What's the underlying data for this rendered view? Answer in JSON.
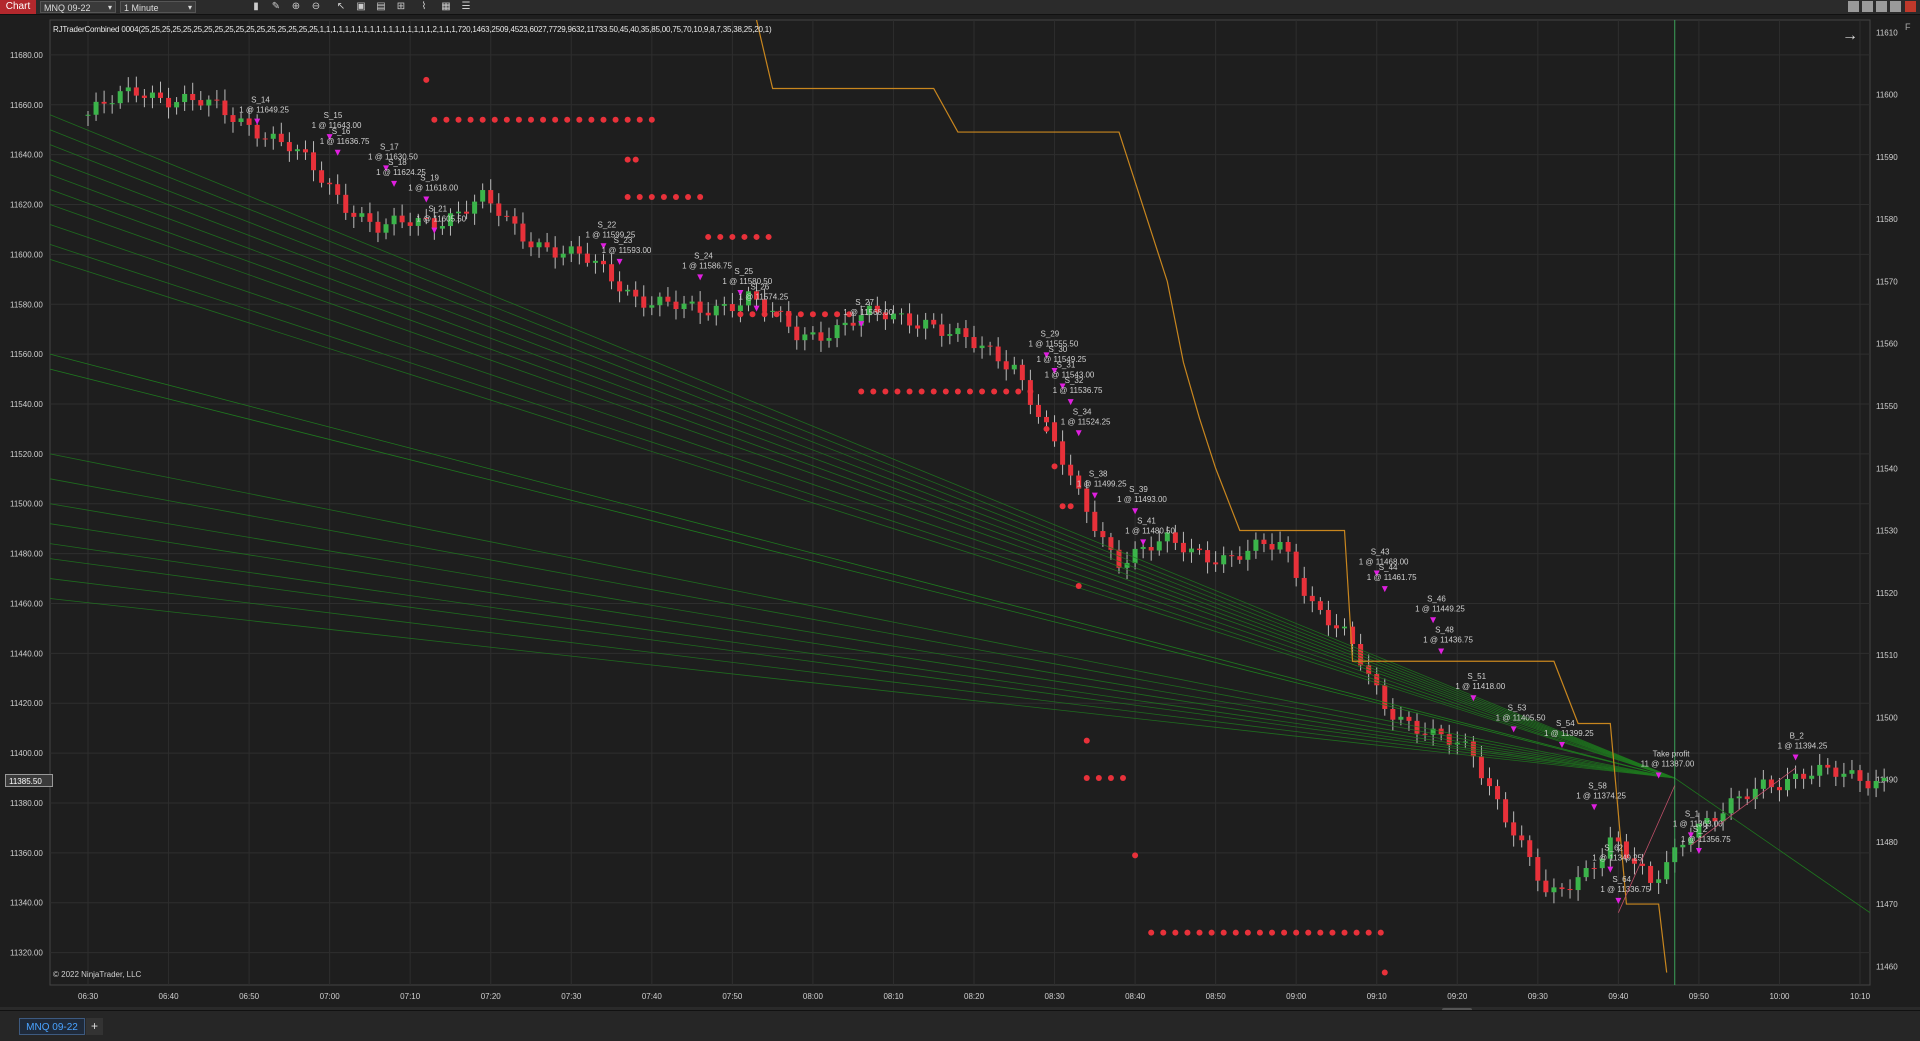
{
  "toolbar": {
    "chart_label": "Chart",
    "instrument": "MNQ 09-22",
    "interval": "1 Minute",
    "tools": [
      "bars-icon",
      "pencil-icon",
      "line-icon",
      "zoom-in-icon",
      "zoom-out-icon",
      "pointer-icon",
      "template-icon",
      "properties-icon",
      "data-box-icon",
      "strategy-icon",
      "indicator-icon",
      "list-icon"
    ]
  },
  "indicator_label": "RJTraderCombined 0004(25,25,25,25,25,25,25,25,25,25,25,25,25,25,25,25,25,1,1,1,1,1,1,1,1,1,1,1,1,1,1,1,1,1,1,2,1,1,1,720,1463,2509,4523,6027,7729,9632,11733.50,45,40,35,85,00,75,70,10,9,8,7,35,38,25,20,1)",
  "copyright": "© 2022 NinjaTrader, LLC",
  "bottom": {
    "instrument_tab": "MNQ 09-22",
    "add_tab": "+"
  },
  "price_marker": "11385.50",
  "corner_label": "F",
  "chart_data": {
    "type": "candlestick",
    "left_axis": {
      "ticks": [
        "11680.00",
        "11660.00",
        "11640.00",
        "11620.00",
        "11600.00",
        "11580.00",
        "11560.00",
        "11540.00",
        "11520.00",
        "11500.00",
        "11480.00",
        "11460.00",
        "11440.00",
        "11420.00",
        "11400.00",
        "11380.00",
        "11360.00",
        "11340.00",
        "11320.00"
      ],
      "range": [
        11307,
        11694
      ]
    },
    "right_axis": {
      "ticks": [
        "11610",
        "11600",
        "11590",
        "11580",
        "11570",
        "11560",
        "11550",
        "11540",
        "11530",
        "11520",
        "11510",
        "11500",
        "11490",
        "11480",
        "11470",
        "11460"
      ],
      "range": [
        11457,
        11612
      ]
    },
    "x_ticks": [
      "06:30",
      "06:40",
      "06:50",
      "07:00",
      "07:10",
      "07:20",
      "07:30",
      "07:40",
      "07:50",
      "08:00",
      "08:10",
      "08:20",
      "08:30",
      "08:40",
      "08:50",
      "09:00",
      "09:10",
      "09:20",
      "09:30",
      "09:40",
      "09:50",
      "10:00",
      "10:10"
    ],
    "trades": [
      {
        "label": "S_14",
        "fill": "1 @ 11649.25",
        "t": "06:51",
        "price": 11649.25
      },
      {
        "label": "S_15",
        "fill": "1 @ 11643.00",
        "t": "07:00",
        "price": 11643.0
      },
      {
        "label": "S_16",
        "fill": "1 @ 11636.75",
        "t": "07:01",
        "price": 11636.75
      },
      {
        "label": "S_17",
        "fill": "1 @ 11630.50",
        "t": "07:07",
        "price": 11630.5
      },
      {
        "label": "S_18",
        "fill": "1 @ 11624.25",
        "t": "07:08",
        "price": 11624.25
      },
      {
        "label": "S_19",
        "fill": "1 @ 11618.00",
        "t": "07:12",
        "price": 11618.0
      },
      {
        "label": "S_21",
        "fill": "1 @ 11605.50",
        "t": "07:13",
        "price": 11605.5
      },
      {
        "label": "S_22",
        "fill": "1 @ 11599.25",
        "t": "07:34",
        "price": 11599.25
      },
      {
        "label": "S_23",
        "fill": "1 @ 11593.00",
        "t": "07:36",
        "price": 11593.0
      },
      {
        "label": "S_24",
        "fill": "1 @ 11586.75",
        "t": "07:46",
        "price": 11586.75
      },
      {
        "label": "S_25",
        "fill": "1 @ 11580.50",
        "t": "07:51",
        "price": 11580.5
      },
      {
        "label": "S_26",
        "fill": "1 @ 11574.25",
        "t": "07:53",
        "price": 11574.25
      },
      {
        "label": "S_27",
        "fill": "1 @ 11568.00",
        "t": "08:06",
        "price": 11568.0
      },
      {
        "label": "S_29",
        "fill": "1 @ 11555.50",
        "t": "08:29",
        "price": 11555.5
      },
      {
        "label": "S_30",
        "fill": "1 @ 11549.25",
        "t": "08:30",
        "price": 11549.25
      },
      {
        "label": "S_31",
        "fill": "1 @ 11543.00",
        "t": "08:31",
        "price": 11543.0
      },
      {
        "label": "S_32",
        "fill": "1 @ 11536.75",
        "t": "08:32",
        "price": 11536.75
      },
      {
        "label": "S_34",
        "fill": "1 @ 11524.25",
        "t": "08:33",
        "price": 11524.25
      },
      {
        "label": "S_38",
        "fill": "1 @ 11499.25",
        "t": "08:35",
        "price": 11499.25
      },
      {
        "label": "S_39",
        "fill": "1 @ 11493.00",
        "t": "08:40",
        "price": 11493.0
      },
      {
        "label": "S_41",
        "fill": "1 @ 11480.50",
        "t": "08:41",
        "price": 11480.5
      },
      {
        "label": "S_43",
        "fill": "1 @ 11468.00",
        "t": "09:10",
        "price": 11468.0
      },
      {
        "label": "S_44",
        "fill": "1 @ 11461.75",
        "t": "09:11",
        "price": 11461.75
      },
      {
        "label": "S_46",
        "fill": "1 @ 11449.25",
        "t": "09:17",
        "price": 11449.25
      },
      {
        "label": "S_48",
        "fill": "1 @ 11436.75",
        "t": "09:18",
        "price": 11436.75
      },
      {
        "label": "S_51",
        "fill": "1 @ 11418.00",
        "t": "09:22",
        "price": 11418.0
      },
      {
        "label": "S_53",
        "fill": "1 @ 11405.50",
        "t": "09:27",
        "price": 11405.5
      },
      {
        "label": "S_54",
        "fill": "1 @ 11399.25",
        "t": "09:33",
        "price": 11399.25
      },
      {
        "label": "S_58",
        "fill": "1 @ 11374.25",
        "t": "09:37",
        "price": 11374.25
      },
      {
        "label": "S_62",
        "fill": "1 @ 11349.25",
        "t": "09:39",
        "price": 11349.25
      },
      {
        "label": "S_64",
        "fill": "1 @ 11336.75",
        "t": "09:40",
        "price": 11336.75
      },
      {
        "label": "S_1",
        "fill": "1 @ 11363.00",
        "t": "09:49",
        "price": 11363.0
      },
      {
        "label": "S_2",
        "fill": "1 @ 11356.75",
        "t": "09:50",
        "price": 11356.75
      },
      {
        "label": "B_2",
        "fill": "1 @ 11394.25",
        "t": "10:02",
        "price": 11394.25
      },
      {
        "label": "Take profit",
        "fill": "11 @ 11387.00",
        "t": "09:45",
        "price": 11387.0
      }
    ],
    "colors": {
      "bg": "#1e1e1e",
      "up": "#3bb44a",
      "down": "#e8313a",
      "grid": "#2e2e2e",
      "dots": "#e8313a",
      "fan": "#1e7a1e",
      "stair": "#c8861e",
      "vline": "#3ba35a",
      "arrow": "#e01fe0"
    }
  }
}
